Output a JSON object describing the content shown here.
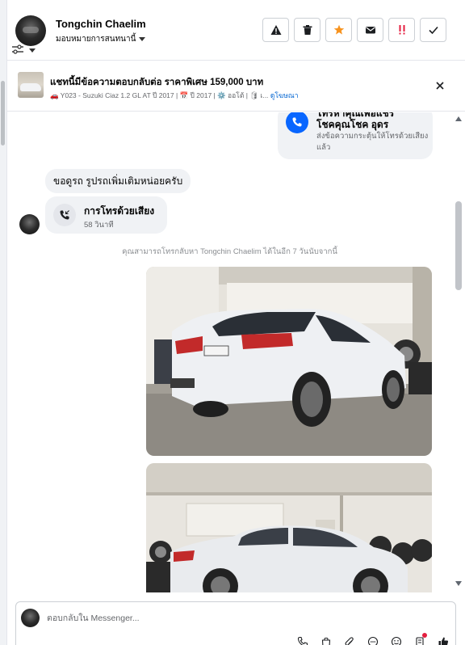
{
  "header": {
    "contact_name": "Tongchin Chaelim",
    "assign_label": "มอบหมายการสนทนานี้"
  },
  "actions": [
    {
      "name": "spam-button",
      "icon": "warning-icon"
    },
    {
      "name": "delete-button",
      "icon": "trash-icon"
    },
    {
      "name": "star-button",
      "icon": "star-icon",
      "color": "#f7931e"
    },
    {
      "name": "mark-unread-button",
      "icon": "envelope-icon"
    },
    {
      "name": "follow-up-button",
      "icon": "exclamation-icon",
      "color": "#e41e3f"
    },
    {
      "name": "done-button",
      "icon": "checkmark-icon"
    }
  ],
  "promo": {
    "title": "แชทนี้มีข้อความตอบกลับต่อ ราคาพิเศษ 159,000 บาท",
    "subtitle": "🚗 Y023 - Suzuki Ciaz 1.2 GL AT ปี 2017 | 📅 ปี 2017 | ⚙️ ออโต้ | 🛢 เ...",
    "link": "ดูโฆษณา"
  },
  "messages": {
    "call_prompt_line1": "โทรหาคุณเพื่อแชร์",
    "call_prompt_line2": "โชคคุณโชค อุดร",
    "call_prompt_desc": "ส่งข้อความกระตุ้นให้โทรด้วยเสียงแล้ว",
    "text_message": "ขอดูรถ รูปรถเพิ่มเติมหน่อยครับ",
    "voice_call_title": "การโทรด้วยเสียง",
    "voice_call_duration": "58 วินาที",
    "callback_note": "คุณสามารถโทรกลับหา Tongchin Chaelim ได้ในอีก 7 วันนับจากนี้"
  },
  "composer": {
    "placeholder": "ตอบกลับใน Messenger..."
  },
  "colors": {
    "accent_blue": "#0866ff",
    "bubble_gray": "#f0f2f5",
    "star_orange": "#f7931e",
    "alert_red": "#e41e3f"
  }
}
